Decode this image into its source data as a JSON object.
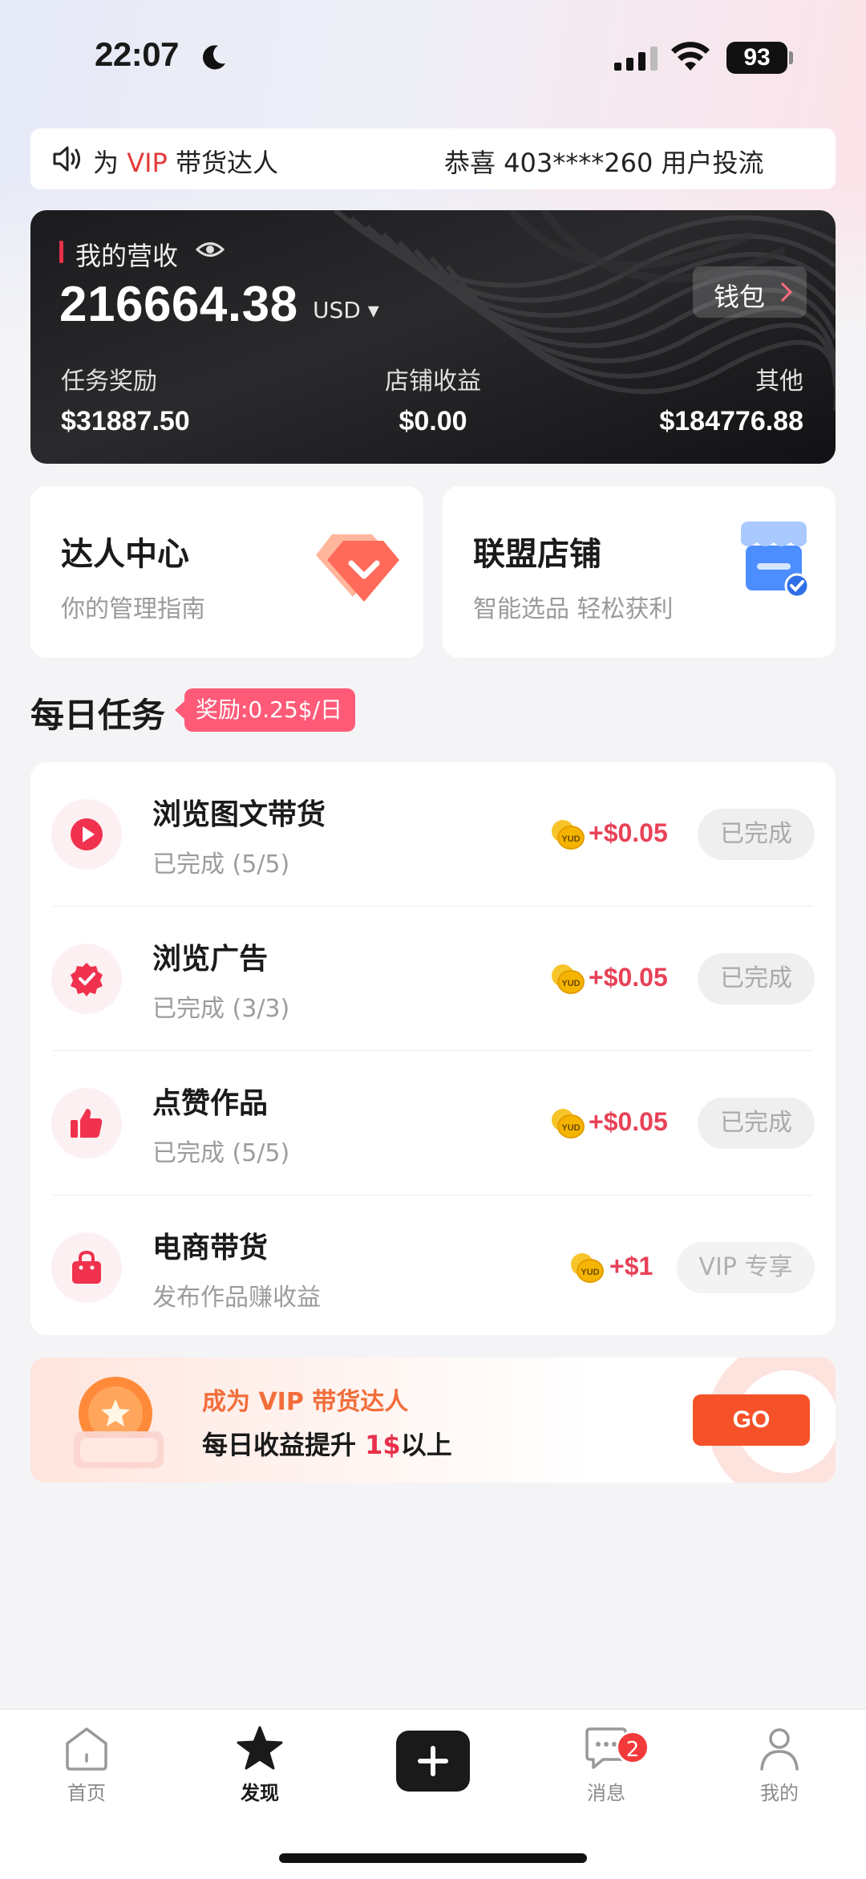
{
  "status_bar": {
    "time": "22:07",
    "battery": "93"
  },
  "notice": {
    "prefix": "为 ",
    "vip": "VIP",
    "suffix": " 带货达人",
    "message": "恭喜 403****260 用户投流"
  },
  "earnings": {
    "title": "我的营收",
    "amount": "216664.38",
    "currency": "USD ▾",
    "wallet_label": "钱包",
    "stats": [
      {
        "label": "任务奖励",
        "value": "$31887.50"
      },
      {
        "label": "店铺收益",
        "value": "$0.00"
      },
      {
        "label": "其他",
        "value": "$184776.88"
      }
    ]
  },
  "features": [
    {
      "title": "达人中心",
      "subtitle": "你的管理指南"
    },
    {
      "title": "联盟店铺",
      "subtitle": "智能选品 轻松获利"
    }
  ],
  "daily": {
    "title": "每日任务",
    "reward_tag": "奖励:0.25$/日",
    "tasks": [
      {
        "name": "浏览图文带货",
        "status": "已完成 (5/5)",
        "reward": "+$0.05",
        "button": "已完成",
        "icon": "play-icon"
      },
      {
        "name": "浏览广告",
        "status": "已完成 (3/3)",
        "reward": "+$0.05",
        "button": "已完成",
        "icon": "verified-badge-icon"
      },
      {
        "name": "点赞作品",
        "status": "已完成 (5/5)",
        "reward": "+$0.05",
        "button": "已完成",
        "icon": "thumbs-up-icon"
      },
      {
        "name": "电商带货",
        "status": "发布作品赚收益",
        "reward": "+$1",
        "button": "VIP 专享",
        "icon": "shopping-bag-icon"
      }
    ],
    "coin_label": "YUD"
  },
  "vip_banner": {
    "line1": "成为 VIP 带货达人",
    "line2_pre": "每日收益提升 ",
    "line2_hl": "1$",
    "line2_post": "以上",
    "button": "GO"
  },
  "tabbar": {
    "items": [
      {
        "label": "首页"
      },
      {
        "label": "发现"
      },
      {
        "label": "消息",
        "badge": "2"
      },
      {
        "label": "我的"
      }
    ]
  },
  "colors": {
    "accent": "#e8314b",
    "go": "#f5522a",
    "tag": "#ff5b78"
  }
}
